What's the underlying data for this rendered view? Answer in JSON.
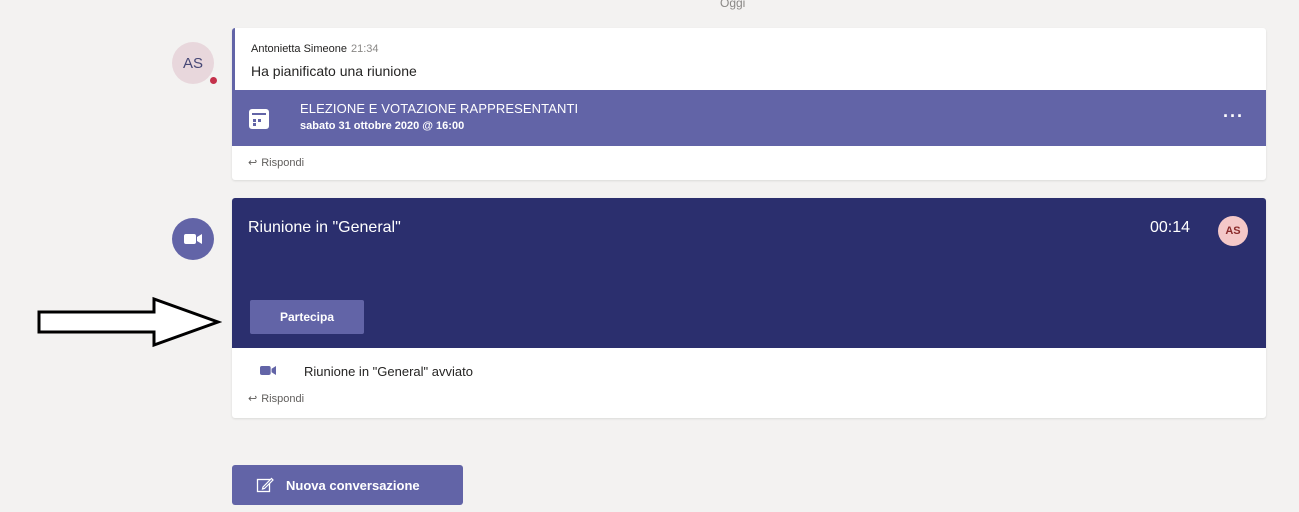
{
  "day_separator": "Oggi",
  "post1": {
    "avatar_initials": "AS",
    "author": "Antonietta Simeone",
    "time": "21:34",
    "message": "Ha pianificato una riunione",
    "meeting": {
      "title": "ELEZIONE E VOTAZIONE RAPPRESENTANTI",
      "date": "sabato 31 ottobre 2020 @ 16:00",
      "more_label": "···"
    },
    "reply_label": "Rispondi"
  },
  "post2": {
    "meeting_title": "Riunione in \"General\"",
    "timer": "00:14",
    "participant_initials": "AS",
    "join_label": "Partecipa",
    "status_text": "Riunione in \"General\" avviato",
    "reply_label": "Rispondi"
  },
  "new_conversation_label": "Nuova conversazione",
  "colors": {
    "accent": "#6264a7",
    "meeting_panel": "#2b2f6e",
    "presence_busy": "#c4314b"
  }
}
